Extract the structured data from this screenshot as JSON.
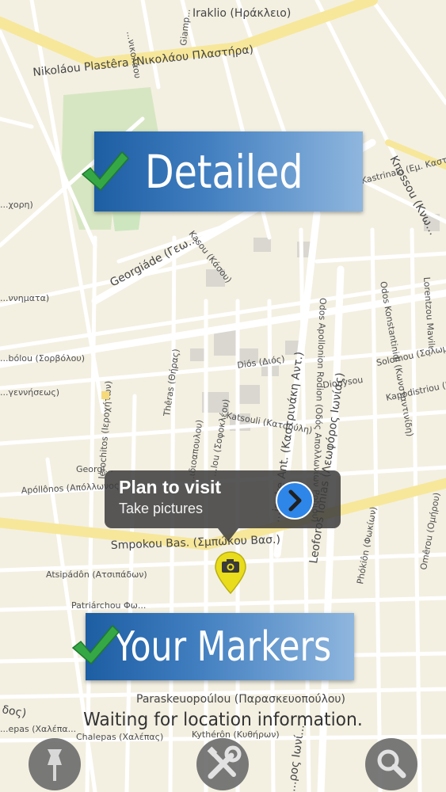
{
  "map": {
    "city_label": "Iraklio (Ηράκλειο)",
    "streets": {
      "nikolaou_plastira": "Nikoláou Plastêra (Νικολάου Πλαστήρα)",
      "georgiade": "Georgiáde (Γεω...",
      "kasou": "Kasou (Κάσου)",
      "knossou": "Knossou (Κνω...",
      "kastrinaki_em": "Kastrinaki (Εμ. Καστ...",
      "zervou": "...χορη)",
      "gennimatas": "...ννηματα)",
      "sorvolou": "...bólou (Σορβόλου)",
      "agennithneos": "...γεννήσεως)",
      "dios": "Diós (Διός)",
      "dionysou": "Dionysou",
      "solomou": "Solomou (Σολωμού)",
      "kapodistriou": "Kapodistriou (Καποδ...",
      "katsouli": "Katsouli (Κατσούλη)",
      "kastrinaki_ant": "...inake Ant. (Καστρινάκη Αντ.)",
      "leoforos_ionias": "Leoforos Ionias (Λεωφόρος Ιωνίας)",
      "thiras": "Thêras (Θήρας)",
      "ierochitos": "Ierochitos (Ιεροχήτων)",
      "georgiou": "Georgi...",
      "apollonos": "Apóllônos (Απόλλωνος)",
      "smpokou": "Smpokou Bas. (Σμπώκου Βασ.)",
      "atsipadon": "Atsipádôn (Ατσιπάδων)",
      "patriarchou": "Patriárchou Φω...",
      "paraskevopoulou": "Paraskeuopoúlou (Παρασκευοπούλου)",
      "chalepas": "Chalepas (Χαλέπας)",
      "chalepas_left": "...epas (Χαλέπα...",
      "kythiron": "Kythérôn (Κυθήρων)",
      "fokion": "Phókiôn (Φωκίων)",
      "omirou": "Omêrou (Ομήρου)",
      "lorentzou": "Lorentzou Mavilι...",
      "konstantinidi": "Odos Konstantinidi (Κωνσταντινίδη)",
      "apollonion": "Odos Apollonion Rodion (Οδός Απολλωνίων Ροδίου)",
      "evridikis": "...ιδιοαπουλου)",
      "giampoudakis": "Giamp...",
      "ierapetras": "...νικολάου",
      "dos": "δος)",
      "ionias_lower": "...ρος Ιωνί...",
      "kastrinaki_short": "...ινάκη Αντ...",
      "odos_sofokleous": "...lou (Σοφοκλέου)"
    }
  },
  "banners": {
    "detailed": "Detailed",
    "your_markers": "Your Markers"
  },
  "callout": {
    "title": "Plan to visit",
    "subtitle": "Take pictures"
  },
  "status": {
    "text": "Waiting for location information."
  },
  "toolbar": {
    "buttons": [
      "pin-icon",
      "tools-icon",
      "search-icon"
    ]
  },
  "colors": {
    "map_background": "#f3f0e2",
    "major_road": "#f7e79a",
    "banner_blue": "#2b6cb0",
    "check_green": "#35a845",
    "callout_bg": "#3c3c3c",
    "disclosure_blue": "#2e86e8",
    "marker_yellow": "#e9dc1c"
  }
}
